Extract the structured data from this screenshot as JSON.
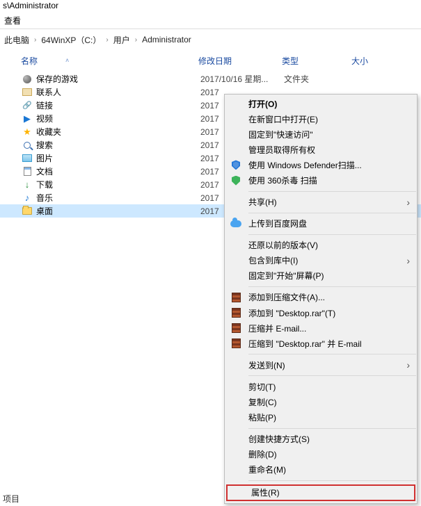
{
  "title_fragment": "s\\Administrator",
  "toolbar": {
    "view": "查看"
  },
  "breadcrumbs": [
    "此电脑",
    "64WinXP（C:）",
    "用户",
    "Administrator"
  ],
  "columns": {
    "name": "名称",
    "date": "修改日期",
    "type": "类型",
    "size": "大小"
  },
  "rows": [
    {
      "icon": "game",
      "label": "保存的游戏",
      "date": "2017/10/16 星期...",
      "type": "文件夹"
    },
    {
      "icon": "contact",
      "label": "联系人",
      "date": "2017"
    },
    {
      "icon": "link",
      "label": "链接",
      "date": "2017"
    },
    {
      "icon": "vid",
      "label": "视频",
      "date": "2017"
    },
    {
      "icon": "star",
      "label": "收藏夹",
      "date": "2017"
    },
    {
      "icon": "mag",
      "label": "搜索",
      "date": "2017"
    },
    {
      "icon": "pict",
      "label": "图片",
      "date": "2017"
    },
    {
      "icon": "doc",
      "label": "文档",
      "date": "2017"
    },
    {
      "icon": "dn",
      "label": "下载",
      "date": "2017"
    },
    {
      "icon": "mus",
      "label": "音乐",
      "date": "2017"
    },
    {
      "icon": "folder",
      "label": "桌面",
      "date": "2017",
      "selected": true
    }
  ],
  "context_menu": [
    {
      "label": "打开(O)",
      "bold": true
    },
    {
      "label": "在新窗口中打开(E)"
    },
    {
      "label": "固定到\"快速访问\""
    },
    {
      "label": "管理员取得所有权"
    },
    {
      "label": "使用 Windows Defender扫描...",
      "icon": "shield-b"
    },
    {
      "label": "使用 360杀毒 扫描",
      "icon": "shield-g"
    },
    {
      "sep": true
    },
    {
      "label": "共享(H)",
      "sub": true
    },
    {
      "sep": true
    },
    {
      "label": "上传到百度网盘",
      "icon": "cloud"
    },
    {
      "sep": true
    },
    {
      "label": "还原以前的版本(V)"
    },
    {
      "label": "包含到库中(I)",
      "sub": true
    },
    {
      "label": "固定到\"开始\"屏幕(P)"
    },
    {
      "sep": true
    },
    {
      "label": "添加到压缩文件(A)...",
      "icon": "rar"
    },
    {
      "label": "添加到 \"Desktop.rar\"(T)",
      "icon": "rar"
    },
    {
      "label": "压缩并 E-mail...",
      "icon": "rar"
    },
    {
      "label": "压缩到 \"Desktop.rar\" 并 E-mail",
      "icon": "rar"
    },
    {
      "sep": true
    },
    {
      "label": "发送到(N)",
      "sub": true
    },
    {
      "sep": true
    },
    {
      "label": "剪切(T)"
    },
    {
      "label": "复制(C)"
    },
    {
      "label": "粘贴(P)"
    },
    {
      "sep": true
    },
    {
      "label": "创建快捷方式(S)"
    },
    {
      "label": "删除(D)"
    },
    {
      "label": "重命名(M)"
    },
    {
      "sep": true
    },
    {
      "label": "属性(R)",
      "hl": true
    }
  ],
  "footer": "项目"
}
